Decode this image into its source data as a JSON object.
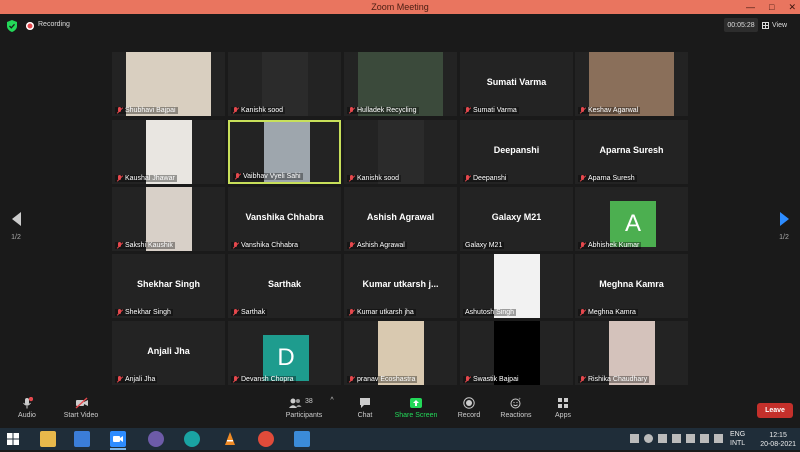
{
  "window": {
    "title": "Zoom Meeting"
  },
  "topbar": {
    "recording_label": "Recording",
    "timer": "00:05:28",
    "view_label": "View"
  },
  "pager": {
    "left_page": "1/2",
    "right_page": "1/2"
  },
  "participants": [
    {
      "name": "Shubhavi Bajpai",
      "display": "",
      "video": true,
      "bg": "#d9cfc0"
    },
    {
      "name": "Kanishk sood",
      "display": "",
      "video": true,
      "bg": "#2b2b2b"
    },
    {
      "name": "Hulladek Recycling",
      "display": "",
      "video": true,
      "bg": "#3b4a3b"
    },
    {
      "name": "Sumati Varma",
      "display": "Sumati Varma",
      "video": false
    },
    {
      "name": "Keshav Agarwal",
      "display": "",
      "video": true,
      "bg": "#8a6f5a"
    },
    {
      "name": "Kaushal Jhawar",
      "display": "",
      "video": true,
      "bg": "#e9e6e1"
    },
    {
      "name": "Vaibhav Vyeli Sahi",
      "display": "",
      "video": true,
      "bg": "#9ea6ad",
      "active": true
    },
    {
      "name": "Kanishk sood",
      "display": "",
      "video": true,
      "bg": "#2b2b2b"
    },
    {
      "name": "Deepanshi",
      "display": "Deepanshi",
      "video": false
    },
    {
      "name": "Aparna Suresh",
      "display": "Aparna Suresh",
      "video": false
    },
    {
      "name": "Sakshi Kaushik",
      "display": "",
      "video": true,
      "bg": "#d8d0c8"
    },
    {
      "name": "Vanshika Chhabra",
      "display": "Vanshika Chhabra",
      "video": false
    },
    {
      "name": "Ashish Agrawal",
      "display": "Ashish Agrawal",
      "video": false
    },
    {
      "name": "Galaxy M21",
      "display": "Galaxy M21",
      "video": false,
      "unmuted": true
    },
    {
      "name": "Abhishek Kumar",
      "display": "",
      "video": false,
      "avatar": "A",
      "avatar_color": "#4caf50"
    },
    {
      "name": "Shekhar Singh",
      "display": "Shekhar Singh",
      "video": false
    },
    {
      "name": "Sarthak",
      "display": "Sarthak",
      "video": false
    },
    {
      "name": "Kumar utkarsh jha",
      "display": "Kumar utkarsh j...",
      "video": false
    },
    {
      "name": "Ashutosh Singh",
      "display": "",
      "video": true,
      "bg": "#f2f2f2",
      "unmuted": true
    },
    {
      "name": "Meghna Kamra",
      "display": "Meghna Kamra",
      "video": false
    },
    {
      "name": "Anjali Jha",
      "display": "Anjali Jha",
      "video": false
    },
    {
      "name": "Devansh Chopra",
      "display": "",
      "video": false,
      "avatar": "D",
      "avatar_color": "#1e9c8e"
    },
    {
      "name": "pranav Ecoshastra",
      "display": "",
      "video": true,
      "bg": "#d9c9b0"
    },
    {
      "name": "Swastik Bajpai",
      "display": "",
      "video": true,
      "bg": "#000000"
    },
    {
      "name": "Rishika Chaudhary",
      "display": "",
      "video": true,
      "bg": "#d4c2bb"
    }
  ],
  "toolbar": {
    "audio": "Audio",
    "start_video": "Start Video",
    "participants": "Participants",
    "participants_count": "38",
    "chat": "Chat",
    "share_screen": "Share Screen",
    "record": "Record",
    "reactions": "Reactions",
    "apps": "Apps",
    "leave": "Leave"
  },
  "taskbar": {
    "lang": "ENG",
    "lang2": "INTL",
    "time": "12:15",
    "date": "20-08-2021"
  },
  "colors": {
    "accent": "#2d8cff",
    "share_green": "#23d959",
    "leave_red": "#c4302b",
    "title_bar": "#e9755f",
    "active_border": "#c8e05a"
  }
}
